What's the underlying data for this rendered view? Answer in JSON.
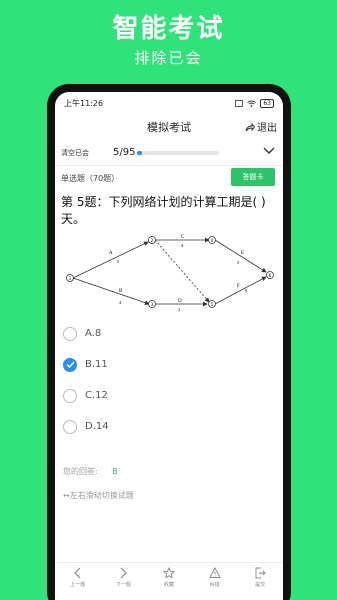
{
  "promo": {
    "title": "智能考试",
    "subtitle": "排除已会"
  },
  "status": {
    "time": "上午11:26",
    "battery": "63"
  },
  "header": {
    "title": "模拟考试",
    "exit_label": "退出"
  },
  "progress": {
    "filter_label": "清空已会",
    "count": "5/95",
    "fraction": 0.05
  },
  "question_type": {
    "label": "单选题（70题）",
    "card_button": "答题卡"
  },
  "question": {
    "text": "第 5题：下列网络计划的计算工期是(  )天。"
  },
  "diagram": {
    "nodes": [
      "1",
      "2",
      "3",
      "4",
      "5",
      "6"
    ],
    "activities": [
      {
        "label": "A",
        "duration": "5"
      },
      {
        "label": "B",
        "duration": "4"
      },
      {
        "label": "C",
        "duration": "4"
      },
      {
        "label": "D",
        "duration": "2"
      },
      {
        "label": "E",
        "duration": "5"
      },
      {
        "label": "F",
        "duration": "6"
      }
    ]
  },
  "options": [
    {
      "label": "A.8",
      "checked": false
    },
    {
      "label": "B.11",
      "checked": true
    },
    {
      "label": "C.12",
      "checked": false
    },
    {
      "label": "D.14",
      "checked": false
    }
  ],
  "answer": {
    "label": "您的回答:",
    "value": "B"
  },
  "hint": "↔左右滑动切换试题",
  "bottom_nav": [
    {
      "label": "上一题",
      "icon": "chevron-left-icon"
    },
    {
      "label": "下一题",
      "icon": "chevron-right-icon"
    },
    {
      "label": "收藏",
      "icon": "star-icon"
    },
    {
      "label": "纠错",
      "icon": "warning-icon"
    },
    {
      "label": "提交",
      "icon": "exit-icon"
    }
  ],
  "colors": {
    "background": "#2fe27a",
    "accent": "#2ec36a",
    "blue": "#2b8ef0"
  }
}
